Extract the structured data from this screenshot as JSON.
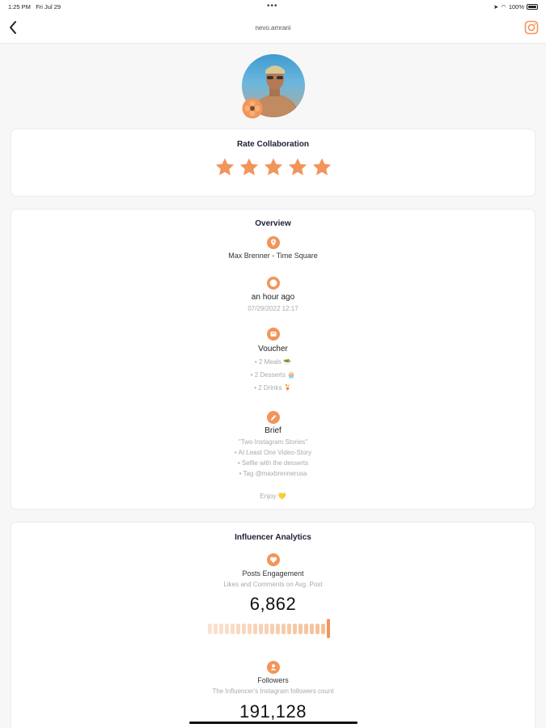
{
  "status_bar": {
    "time": "1:25 PM",
    "date": "Fri Jul 29",
    "battery": "100%"
  },
  "header": {
    "title": "nevo.amrani"
  },
  "rate": {
    "title": "Rate Collaboration",
    "rating": 5,
    "max": 5
  },
  "overview": {
    "title": "Overview",
    "location": "Max Brenner - Time Square",
    "time_ago": "an hour ago",
    "timestamp": "07/29/2022 12:17",
    "voucher_title": "Voucher",
    "voucher_items": [
      "• 2 Meals 🥗",
      "• 2 Desserts 🧁",
      "• 2 Drinks 🍹"
    ],
    "brief_title": "Brief",
    "brief_lines": [
      "\"Two Instagram Stories\"",
      "• At Least One Video-Story",
      "• Selfie with the desserts",
      "• Tag @maxbrennerusa"
    ],
    "enjoy": "Enjoy 💛"
  },
  "analytics": {
    "title": "Influencer Analytics",
    "engagement_title": "Posts Engagement",
    "engagement_sub": "Likes and Comments on Avg. Post",
    "engagement_value": "6,862",
    "engagement_level": 1.0,
    "followers_title": "Followers",
    "followers_sub": "The Influencer's Instagram followers count",
    "followers_value": "191,128"
  },
  "colors": {
    "accent": "#f2955a",
    "accent_light": "#f5be95"
  },
  "icons": [
    "back-chevron-icon",
    "instagram-icon",
    "location-pin-icon",
    "clock-icon",
    "voucher-icon",
    "brief-icon",
    "heart-icon",
    "followers-icon",
    "star-icon",
    "flower-badge-icon"
  ]
}
